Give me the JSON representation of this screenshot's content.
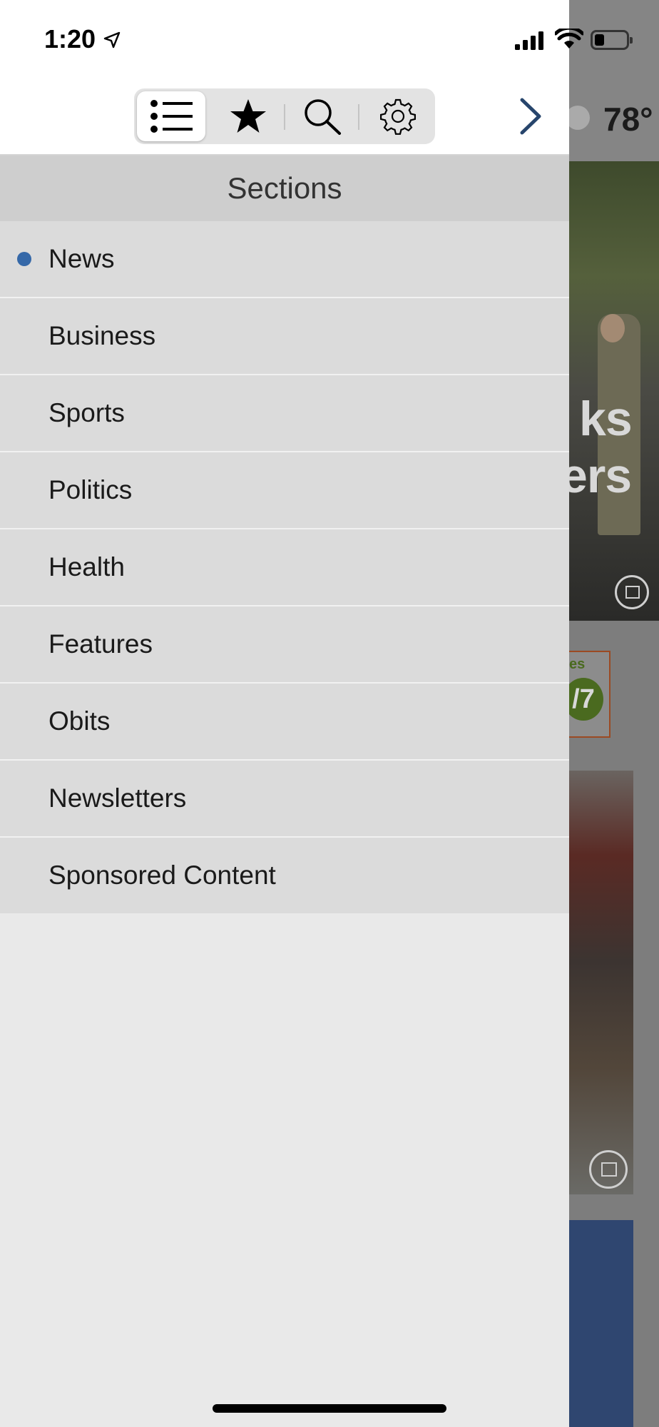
{
  "status_bar": {
    "time": "1:20",
    "battery_level": 0.3
  },
  "toolbar": {
    "tabs": [
      {
        "name": "sections",
        "icon": "list-icon",
        "active": true
      },
      {
        "name": "favorites",
        "icon": "star-icon",
        "active": false
      },
      {
        "name": "search",
        "icon": "search-icon",
        "active": false
      },
      {
        "name": "settings",
        "icon": "gear-icon",
        "active": false
      }
    ],
    "next_icon": "chevron-right-icon"
  },
  "sections": {
    "title": "Sections",
    "selected_index": 0,
    "items": [
      {
        "label": "News"
      },
      {
        "label": "Business"
      },
      {
        "label": "Sports"
      },
      {
        "label": "Politics"
      },
      {
        "label": "Health"
      },
      {
        "label": "Features"
      },
      {
        "label": "Obits"
      },
      {
        "label": "Newsletters"
      },
      {
        "label": "Sponsored Content"
      }
    ]
  },
  "background": {
    "temperature": "78°",
    "headline_line1": "ks",
    "headline_line2": "ers",
    "ad_text": "/7",
    "ad_text_top": "es"
  },
  "colors": {
    "accent": "#3568a8",
    "chevron": "#27456c",
    "drawer_bg": "#e9e9e9",
    "item_bg": "#dbdbdb",
    "header_bg": "#cecece"
  }
}
